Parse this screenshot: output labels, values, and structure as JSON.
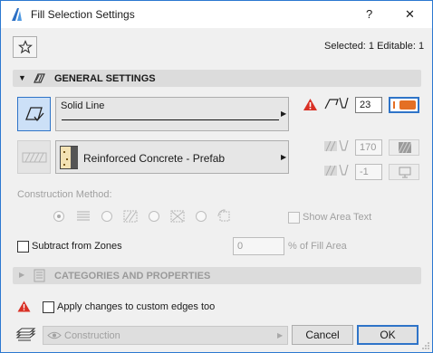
{
  "window": {
    "title": "Fill Selection Settings",
    "help_label": "?",
    "close_label": "✕"
  },
  "header": {
    "selection_info": "Selected: 1 Editable: 1"
  },
  "general_settings": {
    "title": "GENERAL SETTINGS",
    "line_type": "Solid Line",
    "pen_number": "23",
    "pen_color": "#e46f25",
    "fill_type": "Reinforced Concrete - Prefab",
    "bg_pen_number": "170",
    "fg_pen_number": "-1",
    "construction_method_label": "Construction Method:",
    "show_area_text_label": "Show Area Text",
    "subtract_from_zones_label": "Subtract from Zones",
    "fill_area_value": "0",
    "fill_area_suffix": "% of Fill Area"
  },
  "categories": {
    "title": "CATEGORIES AND PROPERTIES"
  },
  "footer": {
    "apply_custom_edges_label": "Apply changes to custom edges too",
    "layer_value": "Construction",
    "cancel_label": "Cancel",
    "ok_label": "OK"
  },
  "colors": {
    "warning": "#d93025",
    "accent_border": "#2f74c8",
    "selected_tool_bg": "#cce0f7"
  }
}
